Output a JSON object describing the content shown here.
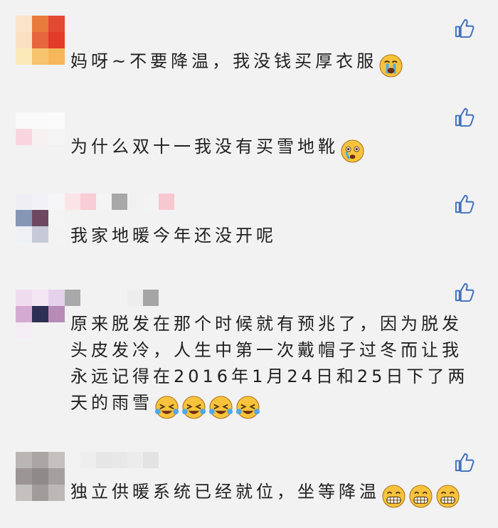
{
  "comments": [
    {
      "text": "妈呀~不要降温，我没钱买厚衣服",
      "emojis": [
        "crying-face-icon"
      ]
    },
    {
      "text": "为什么双十一我没有买雪地靴",
      "emojis": [
        "crying-face-icon"
      ]
    },
    {
      "text": "我家地暖今年还没开呢",
      "emojis": []
    },
    {
      "text": "原来脱发在那个时候就有预兆了，因为脱发头皮发冷，人生中第一次戴帽子过冬而让我永远记得在2016年1月24日和25日下了两天的雨雪",
      "emojis": [
        "laugh-cry-icon",
        "laugh-cry-icon",
        "laugh-cry-icon",
        "laugh-cry-icon"
      ]
    },
    {
      "text": "独立供暖系统已经就位，坐等降温",
      "emojis": [
        "grin-icon",
        "grin-icon",
        "grin-icon"
      ]
    }
  ],
  "colors": {
    "background": "#f2f2f2",
    "text": "#202020",
    "like_icon": "#3d6fbf",
    "emoji_yellow": "#f7c33c",
    "emoji_tear": "#4fa8e8"
  },
  "icons": {
    "like": "thumbs-up-icon"
  }
}
